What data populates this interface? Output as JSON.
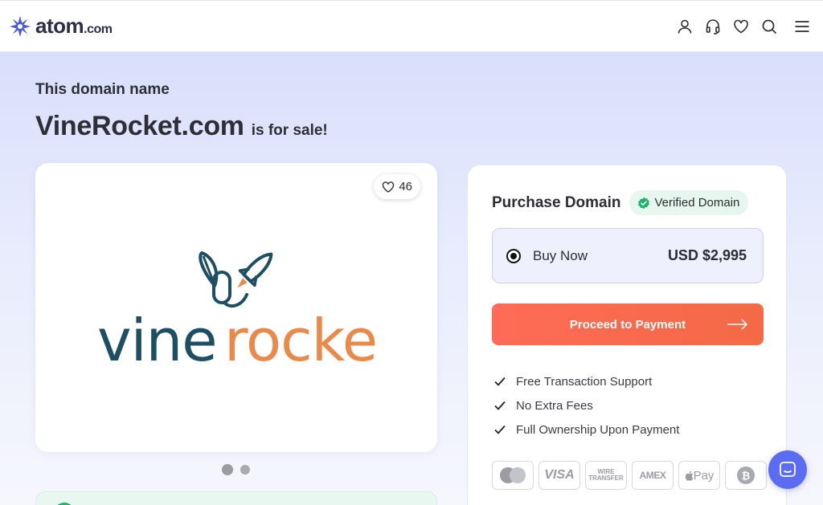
{
  "header": {
    "brand": "atom",
    "brand_tld": ".com",
    "icons": [
      "user-icon",
      "headset-icon",
      "heart-icon",
      "search-icon",
      "menu-icon"
    ]
  },
  "hero": {
    "eyebrow": "This domain name",
    "domain": "VineRocket.com",
    "suffix": "is for sale!"
  },
  "listing": {
    "likes": "46",
    "logo_text_dark": "vine",
    "logo_text_accent": "rocket",
    "logo_colors": {
      "dark": "#1d4e63",
      "accent": "#ea8a4a"
    },
    "slides": 2,
    "active_slide": 1
  },
  "purchase": {
    "title": "Purchase Domain",
    "badge": "Verified Domain",
    "option_label": "Buy Now",
    "option_price": "USD $2,995",
    "cta": "Proceed to Payment",
    "features": [
      "Free Transaction Support",
      "No Extra Fees",
      "Full Ownership Upon Payment"
    ],
    "payment_methods": {
      "mastercard": "",
      "visa": "VISA",
      "wire": "WIRE TRANSFER",
      "amex": "AMEX",
      "applepay": "Pay",
      "bitcoin": "₿"
    }
  },
  "colors": {
    "brand_blue": "#4a5bd4",
    "cta": "#f36a45",
    "verified_green": "#1db36b",
    "chat": "#5b6cf2"
  }
}
